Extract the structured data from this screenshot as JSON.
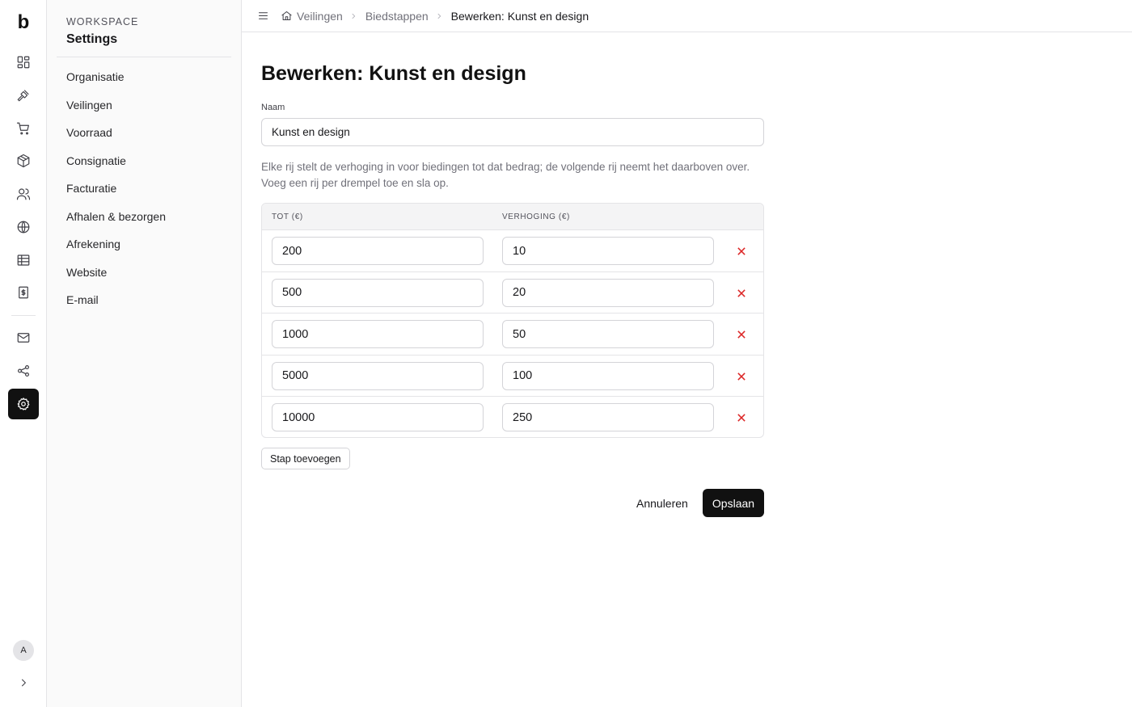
{
  "rail": {
    "logo": "b",
    "avatar_initial": "A",
    "items": [
      {
        "icon": "dashboard-icon"
      },
      {
        "icon": "gavel-icon"
      },
      {
        "icon": "cart-icon"
      },
      {
        "icon": "package-icon"
      },
      {
        "icon": "users-icon"
      },
      {
        "icon": "globe-icon"
      },
      {
        "icon": "table-icon"
      },
      {
        "icon": "invoice-icon"
      },
      {
        "icon": "mail-icon"
      },
      {
        "icon": "share-icon"
      },
      {
        "icon": "gear-icon",
        "active": true
      }
    ]
  },
  "sidebar": {
    "eyebrow": "WORKSPACE",
    "title": "Settings",
    "items": [
      {
        "label": "Organisatie"
      },
      {
        "label": "Veilingen"
      },
      {
        "label": "Voorraad"
      },
      {
        "label": "Consignatie"
      },
      {
        "label": "Facturatie"
      },
      {
        "label": "Afhalen & bezorgen"
      },
      {
        "label": "Afrekening"
      },
      {
        "label": "Website"
      },
      {
        "label": "E-mail"
      }
    ]
  },
  "breadcrumb": {
    "items": [
      "Veilingen",
      "Biedstappen",
      "Bewerken: Kunst en design"
    ]
  },
  "main": {
    "title": "Bewerken: Kunst en design",
    "name_label": "Naam",
    "name_value": "Kunst en design",
    "help_text": "Elke rij stelt de verhoging in voor biedingen tot dat bedrag; de volgende rij neemt het daarboven over. Voeg een rij per drempel toe en sla op.",
    "table": {
      "col_to": "TOT (€)",
      "col_increment": "VERHOGING (€)",
      "rows": [
        {
          "to": "200",
          "increment": "10"
        },
        {
          "to": "500",
          "increment": "20"
        },
        {
          "to": "1000",
          "increment": "50"
        },
        {
          "to": "5000",
          "increment": "100"
        },
        {
          "to": "10000",
          "increment": "250"
        }
      ]
    },
    "add_step_label": "Stap toevoegen",
    "cancel_label": "Annuleren",
    "save_label": "Opslaan"
  },
  "colors": {
    "accent": "#111111",
    "danger": "#dc2626",
    "border": "#e4e4e7",
    "sidebar_bg": "#fafafa"
  }
}
